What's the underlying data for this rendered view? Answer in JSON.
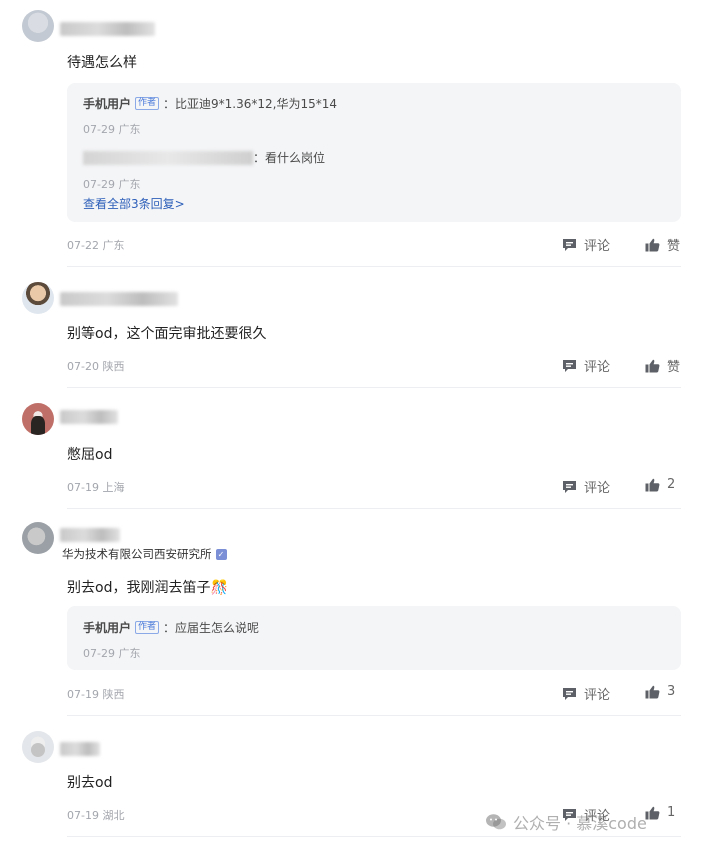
{
  "comments": [
    {
      "text": "待遇怎么样",
      "date": "07-22",
      "location": "广东",
      "comment_label": "评论",
      "like_label": "赞",
      "replies": [
        {
          "name": "手机用户",
          "tag": "作者",
          "text": "：比亚迪9*1.36*12,华为15*14",
          "date": "07-29",
          "location": "广东"
        },
        {
          "name": "",
          "text": "：看什么岗位",
          "date": "07-29",
          "location": "广东"
        }
      ],
      "see_all": "查看全部3条回复>"
    },
    {
      "text": "别等od，这个面完审批还要很久",
      "date": "07-20",
      "location": "陕西",
      "comment_label": "评论",
      "like_label": "赞"
    },
    {
      "text": "憋屈od",
      "date": "07-19",
      "location": "上海",
      "comment_label": "评论",
      "like_label": "2"
    },
    {
      "org": "华为技术有限公司西安研究所",
      "text": "别去od，我刚润去笛子🎊",
      "date": "07-19",
      "location": "陕西",
      "comment_label": "评论",
      "like_label": "3",
      "replies": [
        {
          "name": "手机用户",
          "tag": "作者",
          "text": "：应届生怎么说呢",
          "date": "07-29",
          "location": "广东"
        }
      ]
    },
    {
      "text": "别去od",
      "date": "07-19",
      "location": "湖北",
      "comment_label": "评论",
      "like_label": "1"
    }
  ],
  "watermark": "公众号 · 慕溪code",
  "colors": {
    "link": "#2d5fb9",
    "meta": "#a3a6ad",
    "reply_bg": "#f4f5f7",
    "icon": "#5d6066"
  }
}
